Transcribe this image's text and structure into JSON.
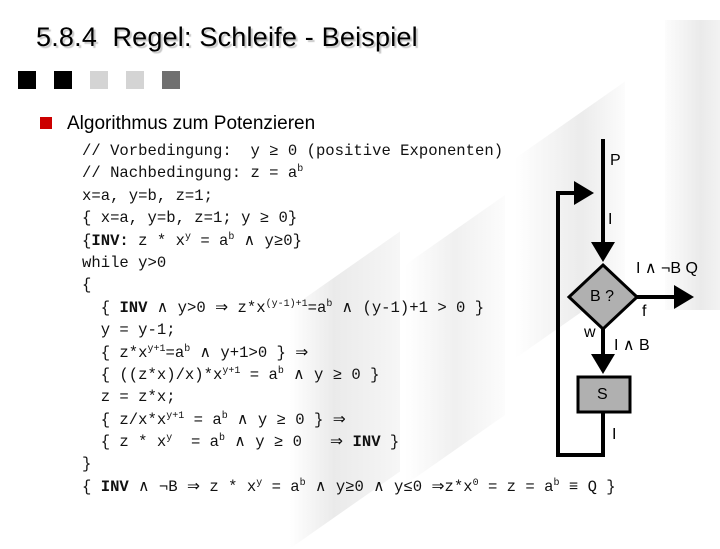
{
  "slide": {
    "title": "5.8.4  Regel: Schleife - Beispiel",
    "decor_squares": [
      {
        "color": "#000000"
      },
      {
        "color": "#000000"
      },
      {
        "color": "#d4d4d4"
      },
      {
        "color": "#d4d4d4"
      },
      {
        "color": "#707070"
      }
    ],
    "bullet_color": "#cc0000",
    "heading": "Algorithmus zum Potenzieren"
  },
  "code": {
    "lines": [
      {
        "parts": [
          {
            "t": "// Vorbedingung:  y ≥ 0 (positive Exponenten)"
          }
        ]
      },
      {
        "parts": [
          {
            "t": "// Nachbedingung: z = a"
          },
          {
            "sup": "b"
          }
        ]
      },
      {
        "parts": [
          {
            "t": "x=a, y=b, z=1;"
          }
        ]
      },
      {
        "parts": [
          {
            "t": "{ x=a, y=b, z=1; y ≥ 0}"
          }
        ]
      },
      {
        "parts": [
          {
            "t": "{"
          },
          {
            "b": "INV:"
          },
          {
            "t": " z * x"
          },
          {
            "sup": "y"
          },
          {
            "t": " = a"
          },
          {
            "sup": "b"
          },
          {
            "t": " ∧ y≥0}"
          }
        ]
      },
      {
        "parts": [
          {
            "t": "while y>0"
          }
        ]
      },
      {
        "parts": [
          {
            "t": "{"
          }
        ]
      },
      {
        "parts": [
          {
            "t": "  { "
          },
          {
            "b": "INV"
          },
          {
            "t": " ∧ y>0 ⇒ z*x"
          },
          {
            "sup": "(y-1)+1"
          },
          {
            "t": "=a"
          },
          {
            "sup": "b"
          },
          {
            "t": " ∧ (y-1)+1 > 0 }"
          }
        ]
      },
      {
        "parts": [
          {
            "t": "  y = y-1;"
          }
        ]
      },
      {
        "parts": [
          {
            "t": "  { z*x"
          },
          {
            "sup": "y+1"
          },
          {
            "t": "=a"
          },
          {
            "sup": "b"
          },
          {
            "t": " ∧ y+1>0 } ⇒"
          }
        ]
      },
      {
        "parts": [
          {
            "t": "  { ((z*x)/x)*x"
          },
          {
            "sup": "y+1"
          },
          {
            "t": " = a"
          },
          {
            "sup": "b"
          },
          {
            "t": " ∧ y ≥ 0 }"
          }
        ]
      },
      {
        "parts": [
          {
            "t": "  z = z*x;"
          }
        ]
      },
      {
        "parts": [
          {
            "t": "  { z/x*x"
          },
          {
            "sup": "y+1"
          },
          {
            "t": " = a"
          },
          {
            "sup": "b"
          },
          {
            "t": " ∧ y ≥ 0 } ⇒"
          }
        ]
      },
      {
        "parts": [
          {
            "t": "  { z * x"
          },
          {
            "sup": "y"
          },
          {
            "t": "  = a"
          },
          {
            "sup": "b"
          },
          {
            "t": " ∧ y ≥ 0   ⇒ "
          },
          {
            "b": "INV"
          },
          {
            "t": " }"
          }
        ]
      },
      {
        "parts": [
          {
            "t": "}"
          }
        ]
      },
      {
        "parts": [
          {
            "t": "{ "
          },
          {
            "b": "INV"
          },
          {
            "t": " ∧ ¬B ⇒ z * x"
          },
          {
            "sup": "y"
          },
          {
            "t": " = a"
          },
          {
            "sup": "b"
          },
          {
            "t": " ∧ y≥0 ∧ y≤0 ⇒z*x"
          },
          {
            "sup": "0"
          },
          {
            "t": " = z = a"
          },
          {
            "sup": "b"
          },
          {
            "t": " ≡ Q }"
          }
        ]
      }
    ]
  },
  "flowchart": {
    "label_pre": "P",
    "label_invariant": "I",
    "label_exit": "I ∧ ¬B Q",
    "decision_label": "B ?",
    "label_false": "f",
    "label_true": "w",
    "label_body_pre": "I ∧ B",
    "statement_label": "S",
    "label_body_post": "I",
    "node_fill": "#b0b0b0"
  }
}
